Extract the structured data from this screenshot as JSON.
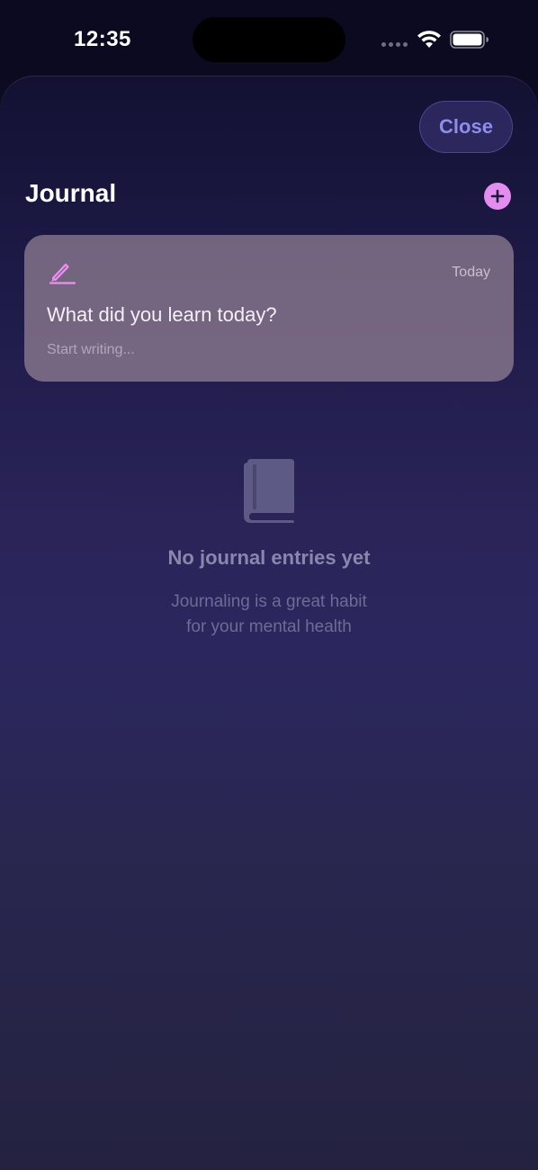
{
  "status_bar": {
    "time": "12:35"
  },
  "header": {
    "close_label": "Close",
    "title": "Journal"
  },
  "prompt_card": {
    "date": "Today",
    "prompt": "What did you learn today?",
    "placeholder": "Start writing..."
  },
  "empty_state": {
    "title": "No journal entries yet",
    "subtitle_line1": "Journaling is a great habit",
    "subtitle_line2": "for your mental health"
  },
  "icons": {
    "add": "plus-icon",
    "prompt": "pencil-icon",
    "empty": "book-icon",
    "wifi": "wifi-icon",
    "battery": "battery-icon"
  },
  "colors": {
    "accent": "#e58cf0",
    "close_text": "#8f8cf0"
  }
}
